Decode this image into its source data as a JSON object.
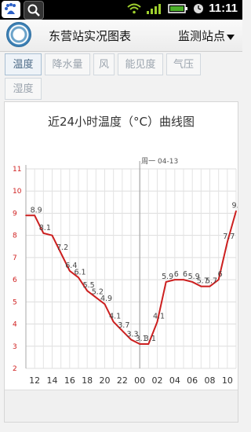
{
  "status_bar": {
    "time": "11:11"
  },
  "app_bar": {
    "title": "东营站实况图表",
    "station_button": "监测站点"
  },
  "tabs": [
    {
      "label": "温度",
      "active": true
    },
    {
      "label": "降水量",
      "active": false
    },
    {
      "label": "风",
      "active": false
    },
    {
      "label": "能见度",
      "active": false
    },
    {
      "label": "气压",
      "active": false
    },
    {
      "label": "湿度",
      "active": false
    }
  ],
  "chart": {
    "title": "近24小时温度（°C）曲线图",
    "date_marker": "周一 04-13"
  },
  "chart_data": {
    "type": "line",
    "title": "近24小时温度（°C）曲线图",
    "y_ticks": [
      2,
      3,
      4,
      5,
      6,
      7,
      8,
      9,
      10,
      11
    ],
    "ylim": [
      2,
      11
    ],
    "x_tick_labels": [
      "12",
      "14",
      "16",
      "18",
      "20",
      "22",
      "00",
      "02",
      "04",
      "06",
      "08",
      "10"
    ],
    "grid": true,
    "series": [
      {
        "color": "#cc1f1f",
        "hours": [
          "11",
          "12",
          "13",
          "14",
          "15",
          "16",
          "17",
          "18",
          "19",
          "20",
          "21",
          "22",
          "23",
          "00",
          "01",
          "02",
          "03",
          "04",
          "05",
          "06",
          "07",
          "08",
          "09",
          "10",
          "11"
        ],
        "values": [
          8.9,
          8.9,
          8.1,
          8.0,
          7.2,
          6.4,
          6.1,
          5.5,
          5.2,
          4.9,
          4.1,
          3.7,
          3.3,
          3.1,
          3.1,
          4.1,
          5.9,
          6.0,
          6.0,
          5.9,
          5.7,
          5.7,
          6.0,
          7.7,
          9.1
        ],
        "labels": [
          "",
          "8.9",
          "8.1",
          "",
          "7.2",
          "6.4",
          "6.1",
          "5.5",
          "5.2",
          "4.9",
          "4.1",
          "3.7",
          "3.3",
          "3.1",
          "3.1",
          "4.1",
          "5.9",
          "6",
          "6",
          "5.9",
          "5.7",
          "5.7",
          "6",
          "7.7",
          "9.1"
        ]
      }
    ]
  }
}
